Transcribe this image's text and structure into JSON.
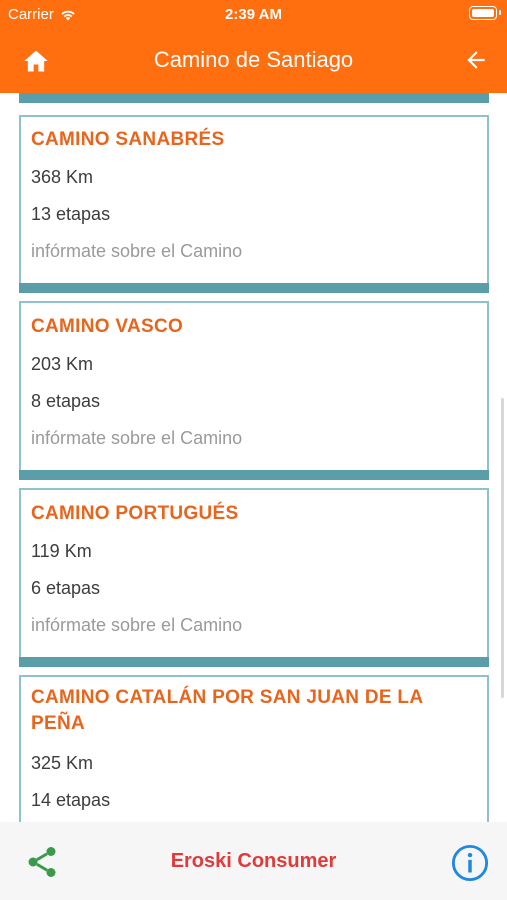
{
  "status_bar": {
    "carrier": "Carrier",
    "time": "2:39 AM"
  },
  "header": {
    "title": "Camino de Santiago"
  },
  "caminos": [
    {
      "name": "CAMINO SANABRÉS",
      "distance": "368 Km",
      "stages": "13 etapas",
      "info": "infórmate sobre el Camino"
    },
    {
      "name": "CAMINO VASCO",
      "distance": "203 Km",
      "stages": "8 etapas",
      "info": "infórmate sobre el Camino"
    },
    {
      "name": "CAMINO PORTUGUÉS",
      "distance": "119 Km",
      "stages": "6 etapas",
      "info": "infórmate sobre el Camino"
    },
    {
      "name": "CAMINO CATALÁN POR SAN JUAN DE LA PEÑA",
      "distance": "325 Km",
      "stages": "14 etapas"
    }
  ],
  "footer": {
    "brand": "Eroski Consumer"
  },
  "colors": {
    "header": "#ff6f0f",
    "title_accent": "#e8651e",
    "card_bar": "#5a9ea9",
    "brand": "#e03a3a",
    "share": "#3a9a4a",
    "info": "#1e88e5"
  }
}
